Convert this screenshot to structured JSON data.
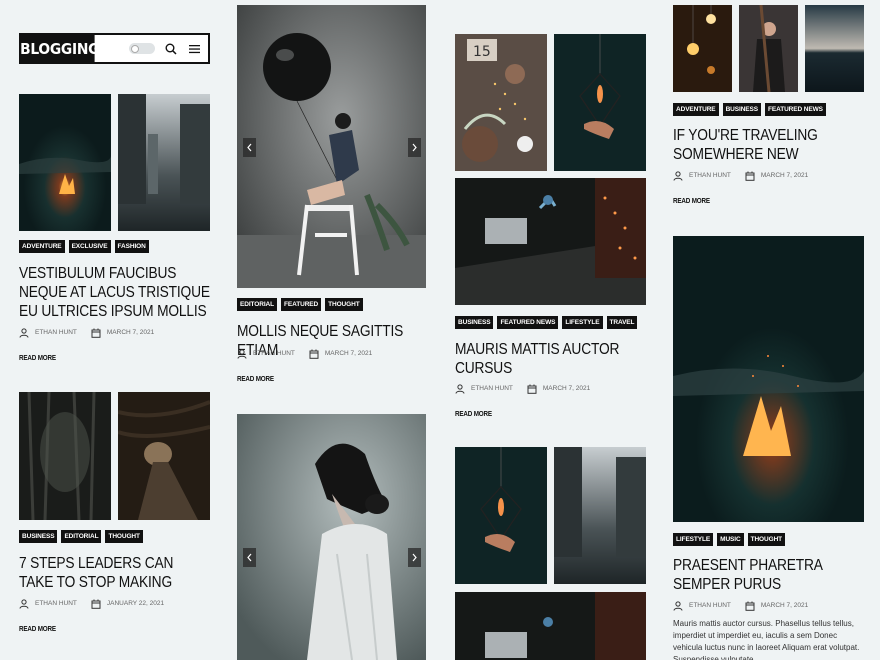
{
  "site": {
    "logo": "BLOGGING"
  },
  "icons": {
    "search": "search-icon",
    "menu": "menu-icon",
    "theme_toggle": "dark-mode-toggle",
    "user": "user-icon",
    "calendar": "calendar-icon",
    "arrow_left": "chevron-left-icon",
    "arrow_right": "chevron-right-icon"
  },
  "posts": [
    {
      "tags": [
        "Adventure",
        "Exclusive",
        "Fashion"
      ],
      "title": "Vestibulum Faucibus Neque At Lacus Tristique Eu Ultrices Ipsum Mollis",
      "author": "Ethan Hunt",
      "date": "March 7, 2021",
      "read_more": "Read More"
    },
    {
      "tags": [
        "Business",
        "Editorial",
        "Thought"
      ],
      "title": "7 Steps Leaders Can Take To Stop Making",
      "author": "Ethan Hunt",
      "date": "January 22, 2021",
      "read_more": "Read More"
    },
    {
      "tags": [
        "Editorial",
        "Featured",
        "Thought"
      ],
      "title": "Mollis Neque Sagittis Etiam",
      "author": "Ethan Hunt",
      "date": "March 7, 2021",
      "read_more": "Read More"
    },
    {
      "tags": [
        "Business",
        "Featured News",
        "Lifestyle",
        "Travel"
      ],
      "title": "Mauris Mattis Auctor Cursus",
      "author": "Ethan Hunt",
      "date": "March 7, 2021",
      "read_more": "Read More"
    },
    {
      "tags": [
        "Adventure",
        "Business",
        "Featured News"
      ],
      "title": "If You're Traveling Somewhere New",
      "author": "Ethan Hunt",
      "date": "March 7, 2021",
      "read_more": "Read More"
    },
    {
      "tags": [
        "Lifestyle",
        "Music",
        "Thought"
      ],
      "title": "Praesent Pharetra Semper Purus",
      "author": "Ethan Hunt",
      "date": "March 7, 2021",
      "excerpt": "Mauris mattis auctor cursus. Phasellus tellus tellus, imperdiet ut imperdiet eu, iaculis a sem Donec vehicula luctus nunc in laoreet Aliquam erat volutpat. Suspendisse vulputate"
    }
  ]
}
